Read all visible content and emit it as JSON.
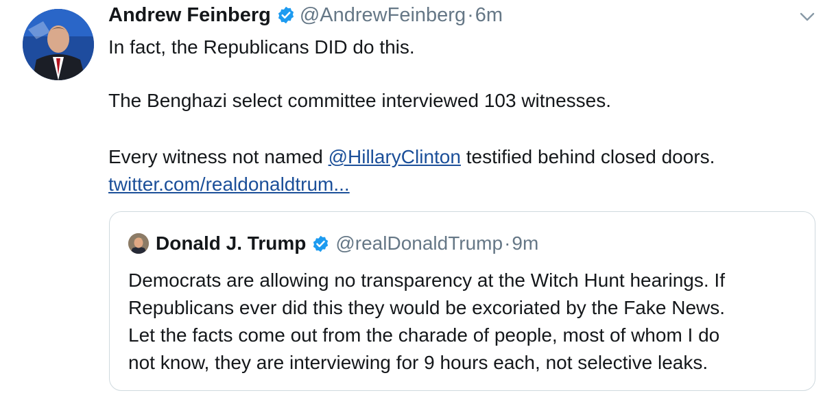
{
  "tweet": {
    "author_name": "Andrew Feinberg",
    "handle": "@AndrewFeinberg",
    "separator": "·",
    "time": "6m",
    "text_line1": "In fact, the Republicans DID do this.",
    "text_line2": "The Benghazi select committee interviewed 103 witnesses.",
    "text_line3_before": "Every witness not named ",
    "mention": "@HillaryClinton",
    "text_line3_after": " testified behind closed doors.",
    "link": "twitter.com/realdonaldtrum..."
  },
  "quoted_tweet": {
    "author_name": "Donald J. Trump",
    "handle": "@realDonaldTrump",
    "separator": "·",
    "time": "9m",
    "lines": [
      "Democrats are allowing no transparency at the Witch Hunt hearings. If",
      "Republicans ever did this they would be excoriated by the Fake News.",
      "Let the facts come out from the charade of people, most of whom I do",
      "not know, they are interviewing for 9 hours each, not selective leaks."
    ]
  },
  "icons": {
    "verified": "verified-badge-icon",
    "menu": "chevron-down-icon"
  },
  "colors": {
    "text": "#14171a",
    "secondary": "#657786",
    "link": "#1b4f99",
    "verified": "#1d9bf0",
    "border": "#cfd9de"
  }
}
